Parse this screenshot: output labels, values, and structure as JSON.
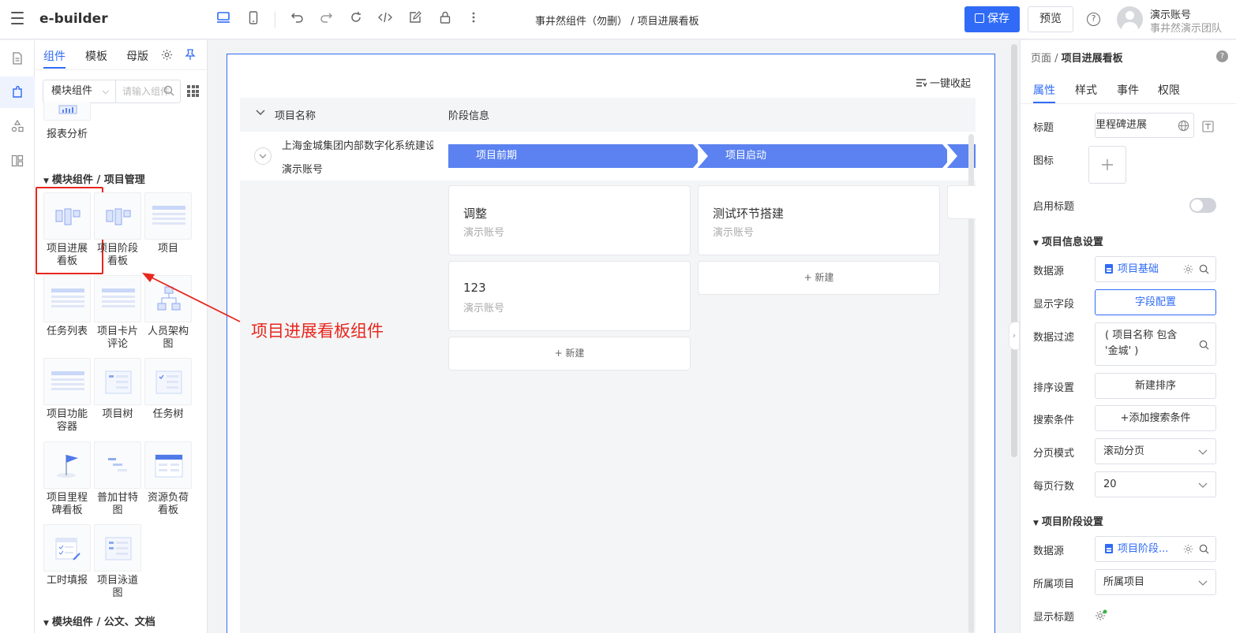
{
  "app": {
    "logo": "e-builder",
    "doc_title": "事井然组件（勿删） / 项目进展看板",
    "save_label": "保存",
    "preview_label": "预览",
    "user_name": "演示账号",
    "user_team": "事井然演示团队",
    "accent": "#2f6bf6"
  },
  "left_panel": {
    "tabs": [
      "组件",
      "模板",
      "母版"
    ],
    "category_select": "模块组件",
    "search_placeholder": "请输入组件名称",
    "prev_item": "报表分析",
    "section_project": "模块组件 / 项目管理",
    "section_docs": "模块组件 / 公文、文档",
    "components": [
      {
        "l1": "项目进展",
        "l2": "看板"
      },
      {
        "l1": "项目阶段",
        "l2": "看板"
      },
      {
        "l1": "项目",
        "l2": ""
      },
      {
        "l1": "任务列表",
        "l2": ""
      },
      {
        "l1": "项目卡片",
        "l2": "评论"
      },
      {
        "l1": "人员架构",
        "l2": "图"
      },
      {
        "l1": "项目功能",
        "l2": "容器"
      },
      {
        "l1": "项目树",
        "l2": ""
      },
      {
        "l1": "任务树",
        "l2": ""
      },
      {
        "l1": "项目里程",
        "l2": "碑看板"
      },
      {
        "l1": "普加甘特",
        "l2": "图"
      },
      {
        "l1": "资源负荷",
        "l2": "看板"
      },
      {
        "l1": "工时填报",
        "l2": ""
      },
      {
        "l1": "项目泳道",
        "l2": "图"
      }
    ]
  },
  "canvas": {
    "one_click_collapse": "一键收起",
    "col_project_name": "项目名称",
    "col_stage_info": "阶段信息",
    "project_name": "上海金城集团内部数字化系统建设",
    "project_owner": "演示账号",
    "stages": [
      "项目前期",
      "项目启动"
    ],
    "stage_color": "#5b82f0",
    "cards_col1": [
      {
        "title": "调整",
        "sub": "演示账号"
      },
      {
        "title": "123",
        "sub": "演示账号"
      }
    ],
    "cards_col2": [
      {
        "title": "测试环节搭建",
        "sub": "演示账号"
      }
    ],
    "new_label": "+ 新建",
    "annotation": "项目进展看板组件",
    "annotation_color": "#e8261c"
  },
  "right_panel": {
    "breadcrumb_root": "页面 /",
    "breadcrumb_current": "项目进展看板",
    "tabs": [
      "属性",
      "样式",
      "事件",
      "权限"
    ],
    "title_label": "标题",
    "title_value": "里程碑进展",
    "icon_label": "图标",
    "enable_title_label": "启用标题",
    "sec_project_info": "项目信息设置",
    "datasource_label": "数据源",
    "datasource1_value": "项目基础",
    "display_fields_label": "显示字段",
    "display_fields_btn": "字段配置",
    "filter_label": "数据过滤",
    "filter_value": "( 项目名称 包含 '金城' )",
    "sort_label": "排序设置",
    "sort_btn": "新建排序",
    "search_cond_label": "搜索条件",
    "search_cond_btn": "+添加搜索条件",
    "paging_label": "分页模式",
    "paging_value": "滚动分页",
    "rows_label": "每页行数",
    "rows_value": "20",
    "sec_stage": "项目阶段设置",
    "datasource2_value": "项目阶段...",
    "owner_project_label": "所属项目",
    "owner_project_value": "所属项目",
    "show_title_label": "显示标题"
  }
}
